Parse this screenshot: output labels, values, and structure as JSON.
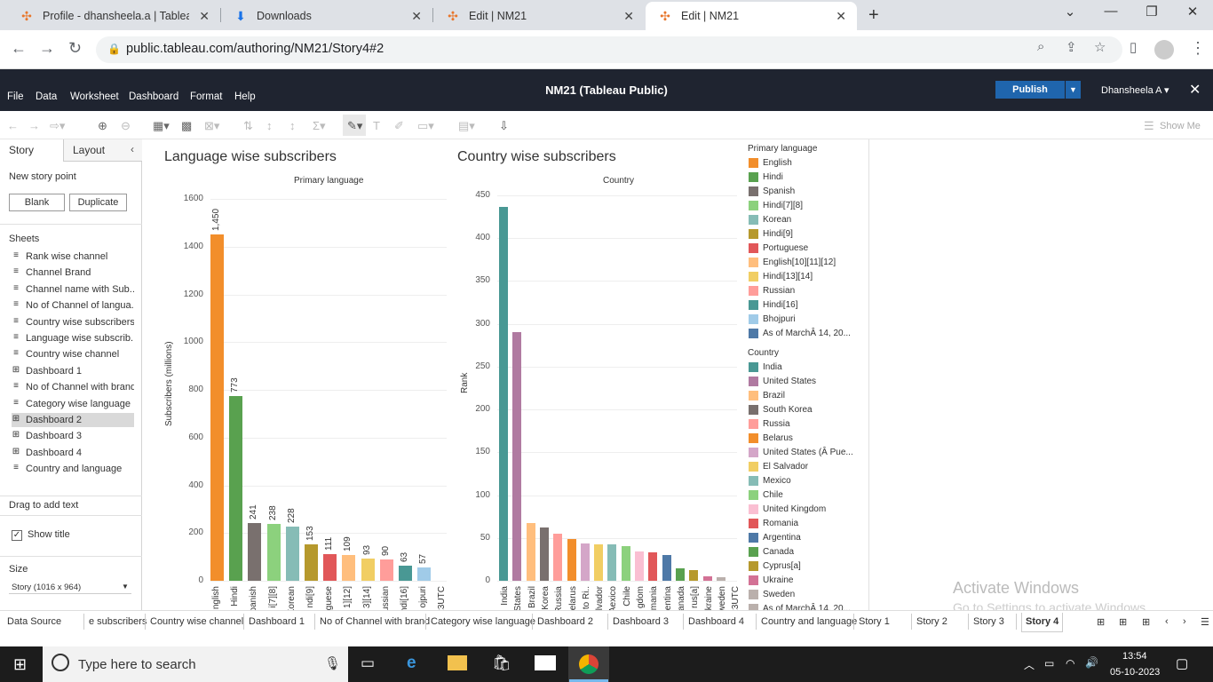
{
  "browser": {
    "tabs": [
      {
        "title": "Profile - dhansheela.a | Tableau P",
        "icon": "tableau-icon"
      },
      {
        "title": "Downloads",
        "icon": "download-icon"
      },
      {
        "title": "Edit | NM21",
        "icon": "tableau-icon"
      },
      {
        "title": "Edit | NM21",
        "icon": "tableau-icon"
      }
    ],
    "url": "public.tableau.com/authoring/NM21/Story4#2"
  },
  "app": {
    "menu": [
      "File",
      "Data",
      "Worksheet",
      "Dashboard",
      "Format",
      "Help"
    ],
    "title": "NM21 (Tableau Public)",
    "publish": "Publish",
    "user": "Dhansheela A ▾",
    "show_me": "Show Me"
  },
  "left": {
    "tabs": [
      "Story",
      "Layout"
    ],
    "new_story_point": "New story point",
    "blank": "Blank",
    "duplicate": "Duplicate",
    "sheets_header": "Sheets",
    "sheets": [
      {
        "name": "Rank wise channel",
        "type": "sheet"
      },
      {
        "name": "Channel Brand",
        "type": "sheet"
      },
      {
        "name": "Channel name with Sub...",
        "type": "sheet"
      },
      {
        "name": "No of Channel of langua...",
        "type": "sheet"
      },
      {
        "name": "Country wise subscribers",
        "type": "sheet"
      },
      {
        "name": "Language wise subscrib...",
        "type": "sheet"
      },
      {
        "name": "Country wise channel",
        "type": "sheet"
      },
      {
        "name": "Dashboard 1",
        "type": "dash"
      },
      {
        "name": "No of Channel with brand",
        "type": "sheet"
      },
      {
        "name": "Category wise language",
        "type": "sheet"
      },
      {
        "name": "Dashboard 2",
        "type": "dash",
        "selected": true
      },
      {
        "name": "Dashboard 3",
        "type": "dash"
      },
      {
        "name": "Dashboard 4",
        "type": "dash"
      },
      {
        "name": "Country and language",
        "type": "sheet"
      }
    ],
    "drag_text": "Drag to add text",
    "show_title": "Show title",
    "size_header": "Size",
    "size_value": "Story (1016 x 964)"
  },
  "chart_data": [
    {
      "type": "bar",
      "title": "Language wise subscribers",
      "subtitle": "Primary language",
      "ylabel": "Subscribers (millions)",
      "ylim": [
        0,
        1600
      ],
      "yticks": [
        0,
        200,
        400,
        600,
        800,
        1000,
        1200,
        1400,
        1600
      ],
      "categories": [
        "English",
        "Hindi",
        "Spanish",
        "Hindi[7][8]",
        "Korean",
        "Hindi[9]",
        "Portuguese",
        "English[10][11][12]",
        "Hindi[13][14]",
        "Russian",
        "Hindi[16]",
        "Bhojpuri",
        "As of MarchÂ 14, 2023UTC"
      ],
      "tick_labels": [
        "nglish",
        "Hindi",
        "panish",
        "i[7][8]",
        "Korean",
        "ndi[9]",
        "rguese",
        "1][12]",
        "3][14]",
        "ussian",
        "ndi[16]",
        "ojpuri",
        "23UTC"
      ],
      "values": [
        1450,
        773,
        241,
        238,
        228,
        153,
        111,
        109,
        93,
        90,
        63,
        57,
        0
      ],
      "data_labels": [
        "1,450",
        "773",
        "241",
        "238",
        "228",
        "153",
        "111",
        "109",
        "93",
        "90",
        "63",
        "57",
        ""
      ],
      "colors": [
        "#f28e2b",
        "#59a14f",
        "#79706e",
        "#8cd17d",
        "#86bcb6",
        "#b6992d",
        "#e15759",
        "#ffbe7d",
        "#f1ce63",
        "#ff9d9a",
        "#499894",
        "#a0cbe8",
        "#4e79a7"
      ]
    },
    {
      "type": "bar",
      "title": "Country wise subscribers",
      "subtitle": "Country",
      "ylabel": "Rank",
      "ylim": [
        0,
        450
      ],
      "yticks": [
        0,
        50,
        100,
        150,
        200,
        250,
        300,
        350,
        400,
        450
      ],
      "categories": [
        "India",
        "United States",
        "Brazil",
        "South Korea",
        "Russia",
        "Belarus",
        "United States (Â Puerto Rico)",
        "El Salvador",
        "Mexico",
        "Chile",
        "United Kingdom",
        "Romania",
        "Argentina",
        "Canada",
        "Cyprus[a]",
        "Ukraine",
        "Sweden",
        "As of MarchÂ 14, 2023UTC"
      ],
      "tick_labels": [
        "India",
        "States",
        "Brazil",
        "Korea",
        "Russia",
        "elarus",
        "to Ri..",
        "lvador",
        "Aexico",
        "Chile",
        "gdom",
        "mania",
        "entina",
        "anada",
        "rus[a]",
        "kraine",
        "weden",
        "23UTC"
      ],
      "values": [
        437,
        290,
        67,
        62,
        55,
        49,
        44,
        43,
        42,
        40,
        34,
        33,
        30,
        15,
        12,
        5,
        4,
        0
      ],
      "colors": [
        "#499894",
        "#b07aa1",
        "#ffbe7d",
        "#79706e",
        "#ff9d9a",
        "#f28e2b",
        "#d4a6c8",
        "#f1ce63",
        "#86bcb6",
        "#8cd17d",
        "#fabfd2",
        "#e15759",
        "#4e79a7",
        "#59a14f",
        "#b6992d",
        "#d37295",
        "#bab0ac",
        "#bab0ac"
      ]
    }
  ],
  "legends": {
    "language_title": "Primary language",
    "language": [
      {
        "label": "English",
        "color": "#f28e2b"
      },
      {
        "label": "Hindi",
        "color": "#59a14f"
      },
      {
        "label": "Spanish",
        "color": "#79706e"
      },
      {
        "label": "Hindi[7][8]",
        "color": "#8cd17d"
      },
      {
        "label": "Korean",
        "color": "#86bcb6"
      },
      {
        "label": "Hindi[9]",
        "color": "#b6992d"
      },
      {
        "label": "Portuguese",
        "color": "#e15759"
      },
      {
        "label": "English[10][11][12]",
        "color": "#ffbe7d"
      },
      {
        "label": "Hindi[13][14]",
        "color": "#f1ce63"
      },
      {
        "label": "Russian",
        "color": "#ff9d9a"
      },
      {
        "label": "Hindi[16]",
        "color": "#499894"
      },
      {
        "label": "Bhojpuri",
        "color": "#a0cbe8"
      },
      {
        "label": "As of MarchÂ 14, 20...",
        "color": "#4e79a7"
      }
    ],
    "country_title": "Country",
    "country": [
      {
        "label": "India",
        "color": "#499894"
      },
      {
        "label": "United States",
        "color": "#b07aa1"
      },
      {
        "label": "Brazil",
        "color": "#ffbe7d"
      },
      {
        "label": "South Korea",
        "color": "#79706e"
      },
      {
        "label": "Russia",
        "color": "#ff9d9a"
      },
      {
        "label": "Belarus",
        "color": "#f28e2b"
      },
      {
        "label": "United States (Â Pue...",
        "color": "#d4a6c8"
      },
      {
        "label": "El Salvador",
        "color": "#f1ce63"
      },
      {
        "label": "Mexico",
        "color": "#86bcb6"
      },
      {
        "label": "Chile",
        "color": "#8cd17d"
      },
      {
        "label": "United Kingdom",
        "color": "#fabfd2"
      },
      {
        "label": "Romania",
        "color": "#e15759"
      },
      {
        "label": "Argentina",
        "color": "#4e79a7"
      },
      {
        "label": "Canada",
        "color": "#59a14f"
      },
      {
        "label": "Cyprus[a]",
        "color": "#b6992d"
      },
      {
        "label": "Ukraine",
        "color": "#d37295"
      },
      {
        "label": "Sweden",
        "color": "#bab0ac"
      },
      {
        "label": "As of MarchÂ 14, 20...",
        "color": "#bab0ac"
      }
    ]
  },
  "bottom_tabs": [
    "Data Source",
    "e subscribers",
    "Country wise channel",
    "Dashboard 1",
    "No of Channel with brand",
    "Category wise language",
    "Dashboard 2",
    "Dashboard 3",
    "Dashboard 4",
    "Country and language",
    "Story 1",
    "Story 2",
    "Story 3",
    "Story 4"
  ],
  "watermark": {
    "line1": "Activate Windows",
    "line2": "Go to Settings to activate Windows."
  },
  "taskbar": {
    "search": "Type here to search",
    "time": "13:54",
    "date": "05-10-2023"
  }
}
